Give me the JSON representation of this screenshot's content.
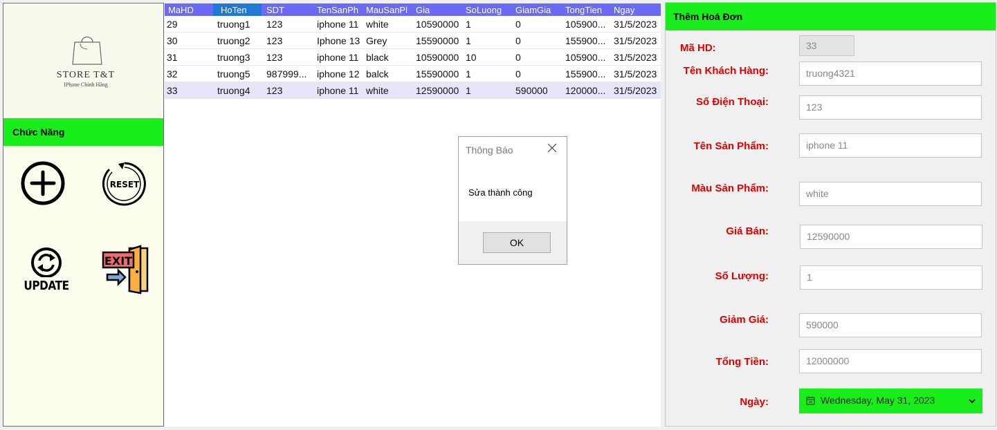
{
  "logo": {
    "name": "STORE T&T",
    "subtitle": "IPhone Chính Hãng"
  },
  "functions": {
    "title": "Chức Năng",
    "reset_label": "RESET",
    "update_label": "UPDATE",
    "exit_label": "EXIT"
  },
  "grid": {
    "columns": [
      "MaHD",
      "HoTen",
      "SDT",
      "TenSanPh",
      "MauSanPl",
      "Gia",
      "SoLuong",
      "GiamGia",
      "TongTien",
      "Ngay"
    ],
    "rows": [
      [
        "29",
        "truong1",
        "123",
        "iphone 11",
        "white",
        "10590000",
        "1",
        "0",
        "105900...",
        "31/5/2023"
      ],
      [
        "30",
        "truong2",
        "123",
        "Iphone 13",
        "Grey",
        "15590000",
        "1",
        "0",
        "155900...",
        "31/5/2023"
      ],
      [
        "31",
        "truong3",
        "123",
        "iphone 11",
        "black",
        "10590000",
        "10",
        "0",
        "105900...",
        "31/5/2023"
      ],
      [
        "32",
        "truong5",
        "987999...",
        "iphone 12",
        "balck",
        "15590000",
        "1",
        "0",
        "155900...",
        "31/5/2023"
      ],
      [
        "33",
        "truong4",
        "123",
        "iphone 11",
        "white",
        "12590000",
        "1",
        "590000",
        "120000...",
        "31/5/2023"
      ]
    ]
  },
  "dialog": {
    "title": "Thông Báo",
    "message": "Sửa thành công",
    "ok_label": "OK"
  },
  "form": {
    "title": "Thêm Hoá Đơn",
    "ma_hd_label": "Mã HD:",
    "ma_hd_value": "33",
    "ten_kh_label": "Tên Khách Hàng:",
    "ten_kh_value": "truong4321",
    "sdt_label": "Số Điện Thoại:",
    "sdt_value": "123",
    "ten_sp_label": "Tên Sản Phẩm:",
    "ten_sp_value": "iphone 11",
    "mau_sp_label": "Màu Sản Phẩm:",
    "mau_sp_value": "white",
    "gia_ban_label": "Giá Bán:",
    "gia_ban_value": "12590000",
    "so_luong_label": "Số Lượng:",
    "so_luong_value": "1",
    "giam_gia_label": "Giảm Giá:",
    "giam_gia_value": "590000",
    "tong_tien_label": "Tổng Tiền:",
    "tong_tien_value": "12000000",
    "ngay_label": "Ngày:",
    "ngay_value": "Wednesday, May 31, 2023"
  },
  "colors": {
    "header_green": "#1aee1a",
    "grid_header": "#6a6af8",
    "label_red": "#e00000",
    "selected_row": "#e6e6fb"
  },
  "icons": [
    "shopping-bag-icon",
    "add-circle-icon",
    "reset-icon",
    "update-icon",
    "exit-door-icon",
    "close-icon",
    "calendar-icon",
    "chevron-down-icon"
  ]
}
